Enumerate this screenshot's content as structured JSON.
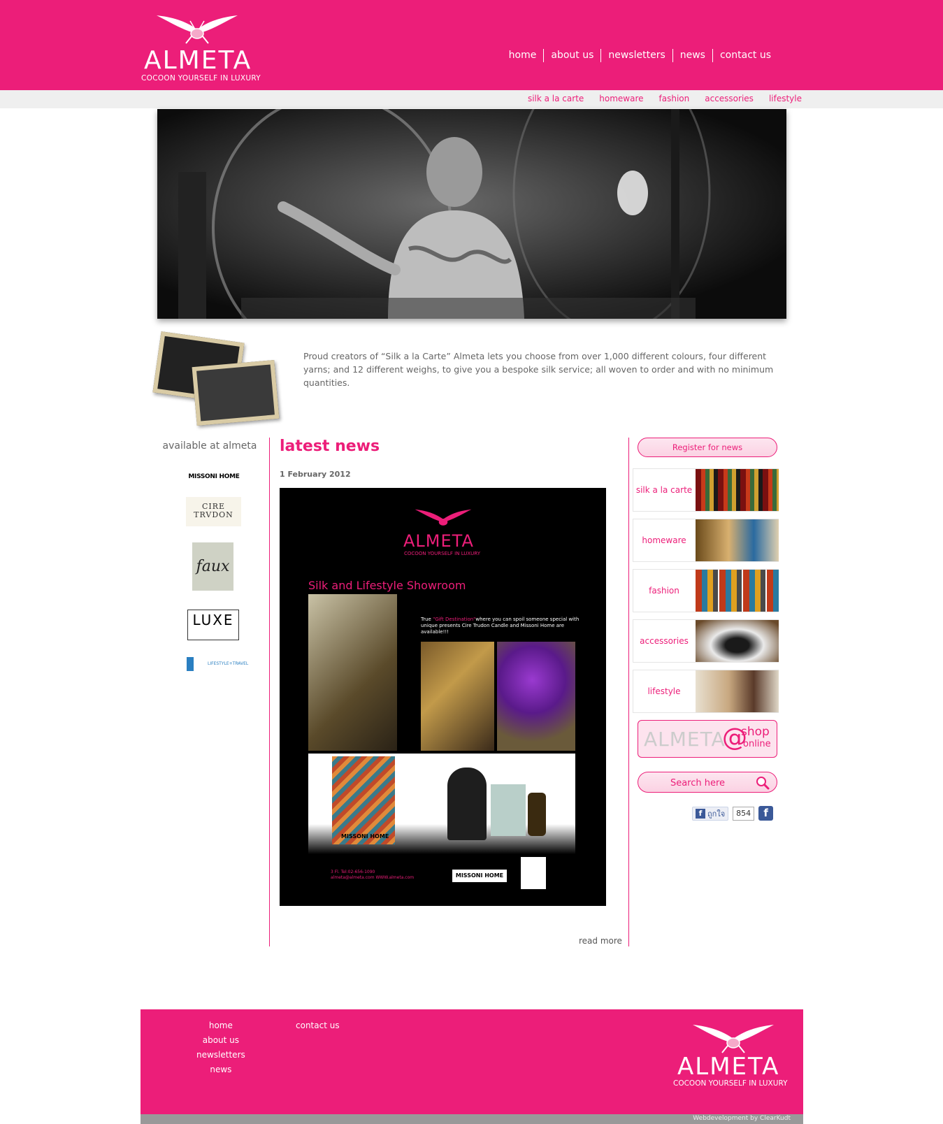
{
  "brand": {
    "name": "ALMETA",
    "tagline": "COCOON YOURSELF IN LUXURY"
  },
  "top_nav": [
    "home",
    "about us",
    "newsletters",
    "news",
    "contact us"
  ],
  "sub_nav": [
    "silk a la carte",
    "homeware",
    "fashion",
    "accessories",
    "lifestyle"
  ],
  "intro": "Proud creators of “Silk a la Carte” Almeta lets you choose from over 1,000 different colours, four different yarns; and 12 different weighs, to give you a bespoke silk service; all woven to order and with no minimum quantities.",
  "left": {
    "heading": "available at almeta",
    "brands": [
      "MISSONI HOME",
      "CIRE TRVDON",
      "faux",
      "LUXE",
      "LIFESTYLE+TRAVEL"
    ]
  },
  "main": {
    "heading": "latest news",
    "date": "1 February 2012",
    "flyer": {
      "brand": "ALMETA",
      "tagline": "COCOON YOURSELF IN LUXURY",
      "title": "Silk and Lifestyle Showroom",
      "blurb_prefix": "True ",
      "blurb_highlight": "\"Gift Destination\"",
      "blurb_rest": "where you can spoil someone special with unique presents Cire Trudon Candle and Missoni Home are available!!!",
      "missoni_label": "MISSONI HOME",
      "contact_1": "3 Fl. Tel:02-656-1090",
      "contact_2": "almeta@almeta.com WWW.almeta.com"
    },
    "read_more": "read more"
  },
  "right": {
    "register": "Register for news",
    "categories": [
      "silk a la carte",
      "homeware",
      "fashion",
      "accessories",
      "lifestyle"
    ],
    "shop": {
      "name": "ALMETA",
      "at": "@",
      "shop": "shop",
      "online": "online"
    },
    "search_placeholder": "Search here",
    "fb_like": "ถูกใจ",
    "fb_count": "854"
  },
  "footer": {
    "col1": [
      "home",
      "about us",
      "newsletters",
      "news"
    ],
    "col2": [
      "contact us"
    ],
    "credit": "Webdevelopment by ClearKudt"
  },
  "colors": {
    "brand_pink": "#ec1e79",
    "subbar_gray": "#efefef",
    "footer_gray": "#999999"
  },
  "icons": [
    "moth-logo-icon",
    "search-icon",
    "facebook-icon"
  ]
}
